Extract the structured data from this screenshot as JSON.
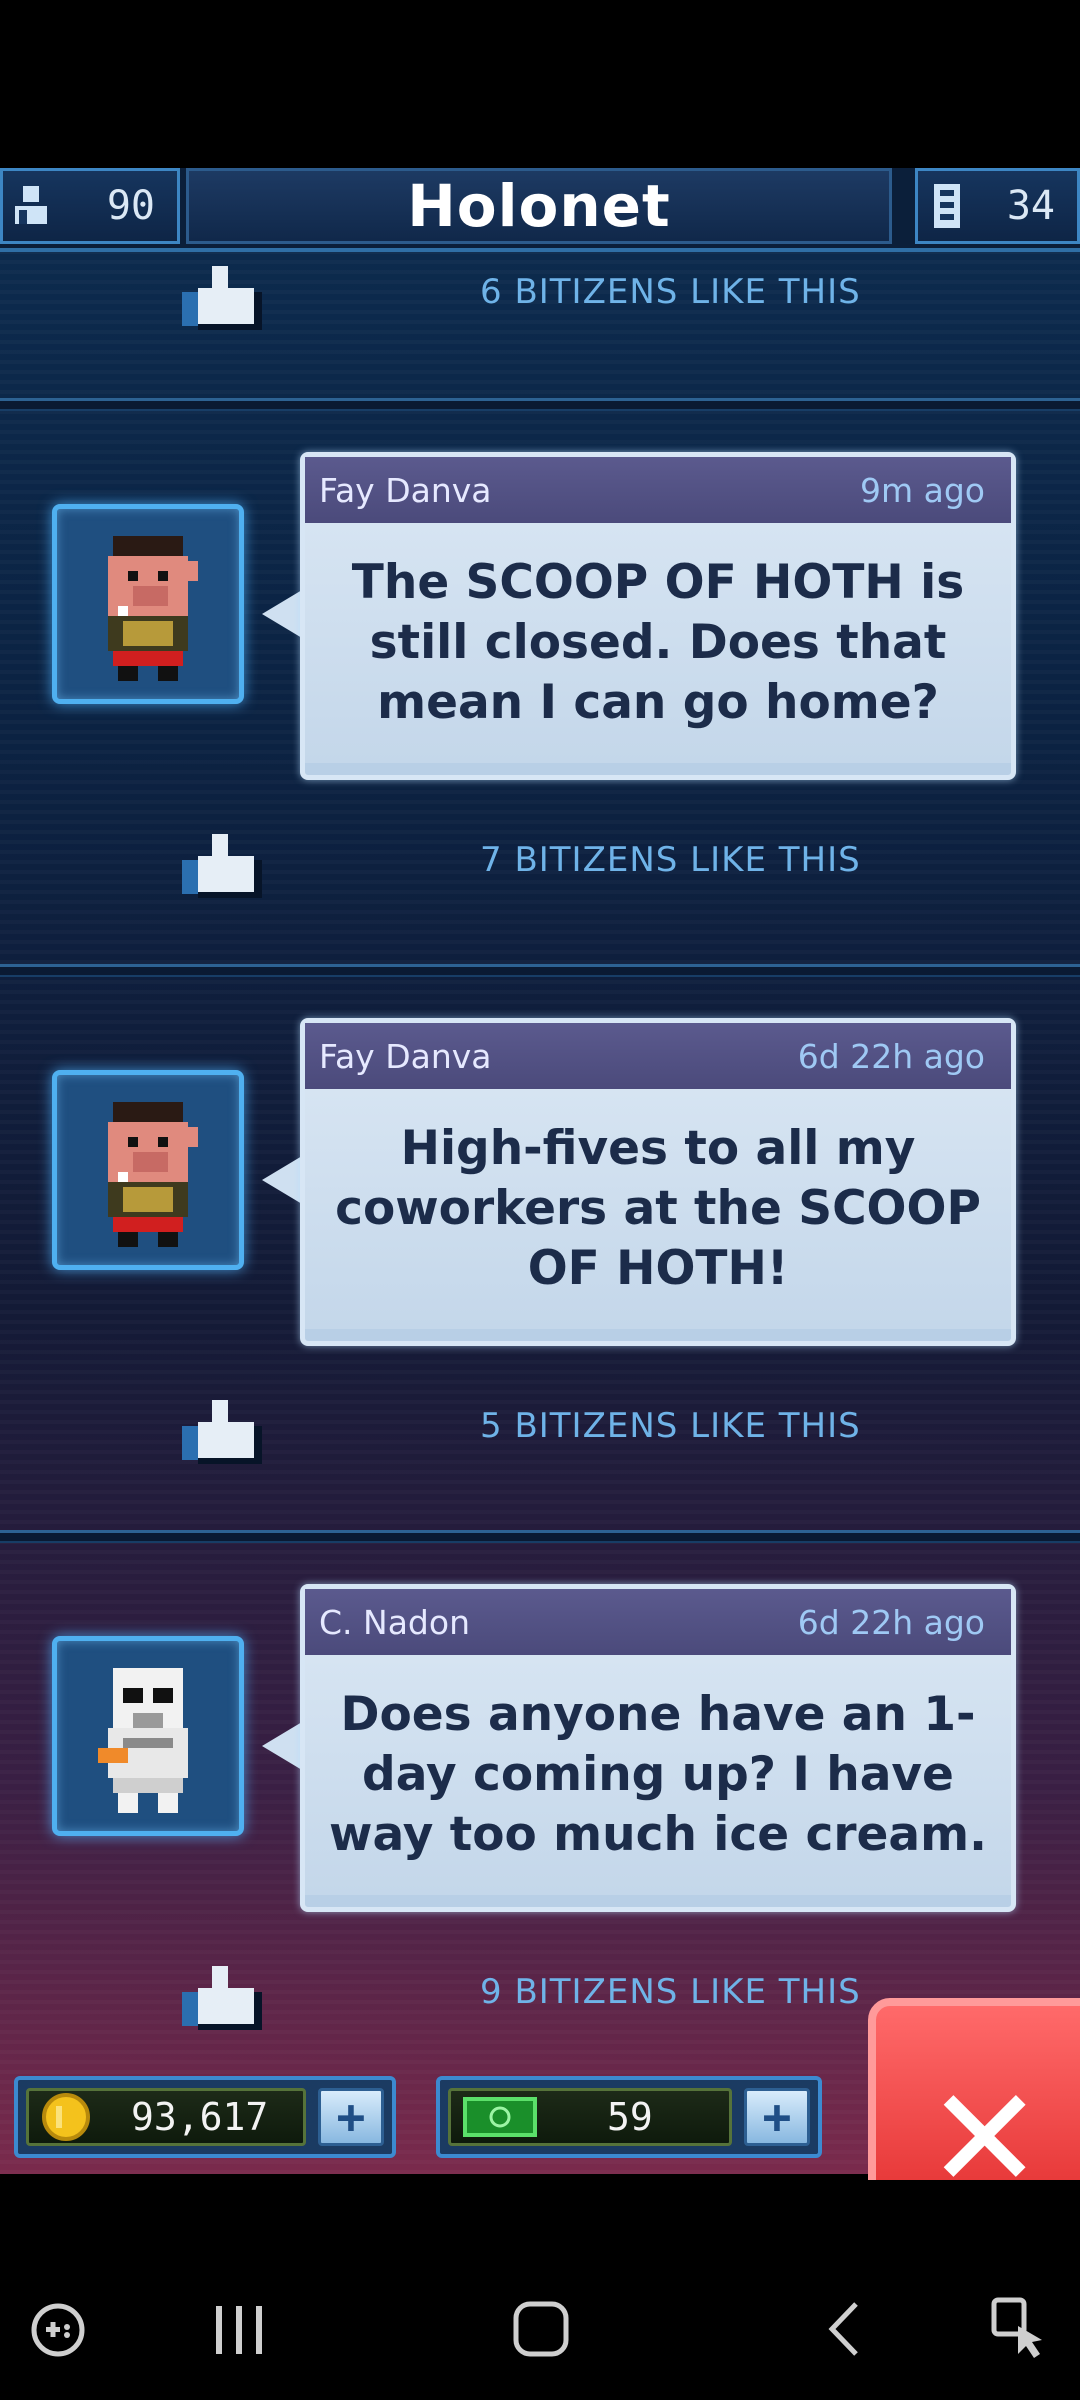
{
  "header": {
    "population_icon": "person-icon",
    "population": "90",
    "title": "Holonet",
    "floors_icon": "floors-icon",
    "floors": "34"
  },
  "feed": {
    "like_suffix": "BITIZENS LIKE THIS",
    "top_like_text": "6 BITIZENS LIKE THIS",
    "posts": [
      {
        "author": "Fay Danva",
        "time": "9m ago",
        "message": "The SCOOP OF HOTH is still closed. Does that mean I can go home?",
        "avatar": "pig-bitizen-avatar",
        "likes_text": "7 BITIZENS LIKE THIS"
      },
      {
        "author": "Fay Danva",
        "time": "6d 22h ago",
        "message": "High-fives to all my coworkers at the SCOOP OF HOTH!",
        "avatar": "pig-bitizen-avatar",
        "likes_text": "5 BITIZENS LIKE THIS"
      },
      {
        "author": "C. Nadon",
        "time": "6d 22h ago",
        "message": "Does anyone have an 1-day coming up? I have way too much ice cream.",
        "avatar": "stormtrooper-bitizen-avatar",
        "likes_text": "9 BITIZENS LIKE THIS"
      }
    ]
  },
  "currency": {
    "coins_icon": "coin-icon",
    "coins": "93,617",
    "bux_icon": "imperial-bux-icon",
    "bux": "59",
    "plus_label": "+"
  },
  "close_label": "✕",
  "colors": {
    "accent_blue": "#4fb0f0",
    "bubble_header": "#5b5a8e",
    "close_red": "#e02a2a",
    "like_text": "#6fb3e8"
  }
}
